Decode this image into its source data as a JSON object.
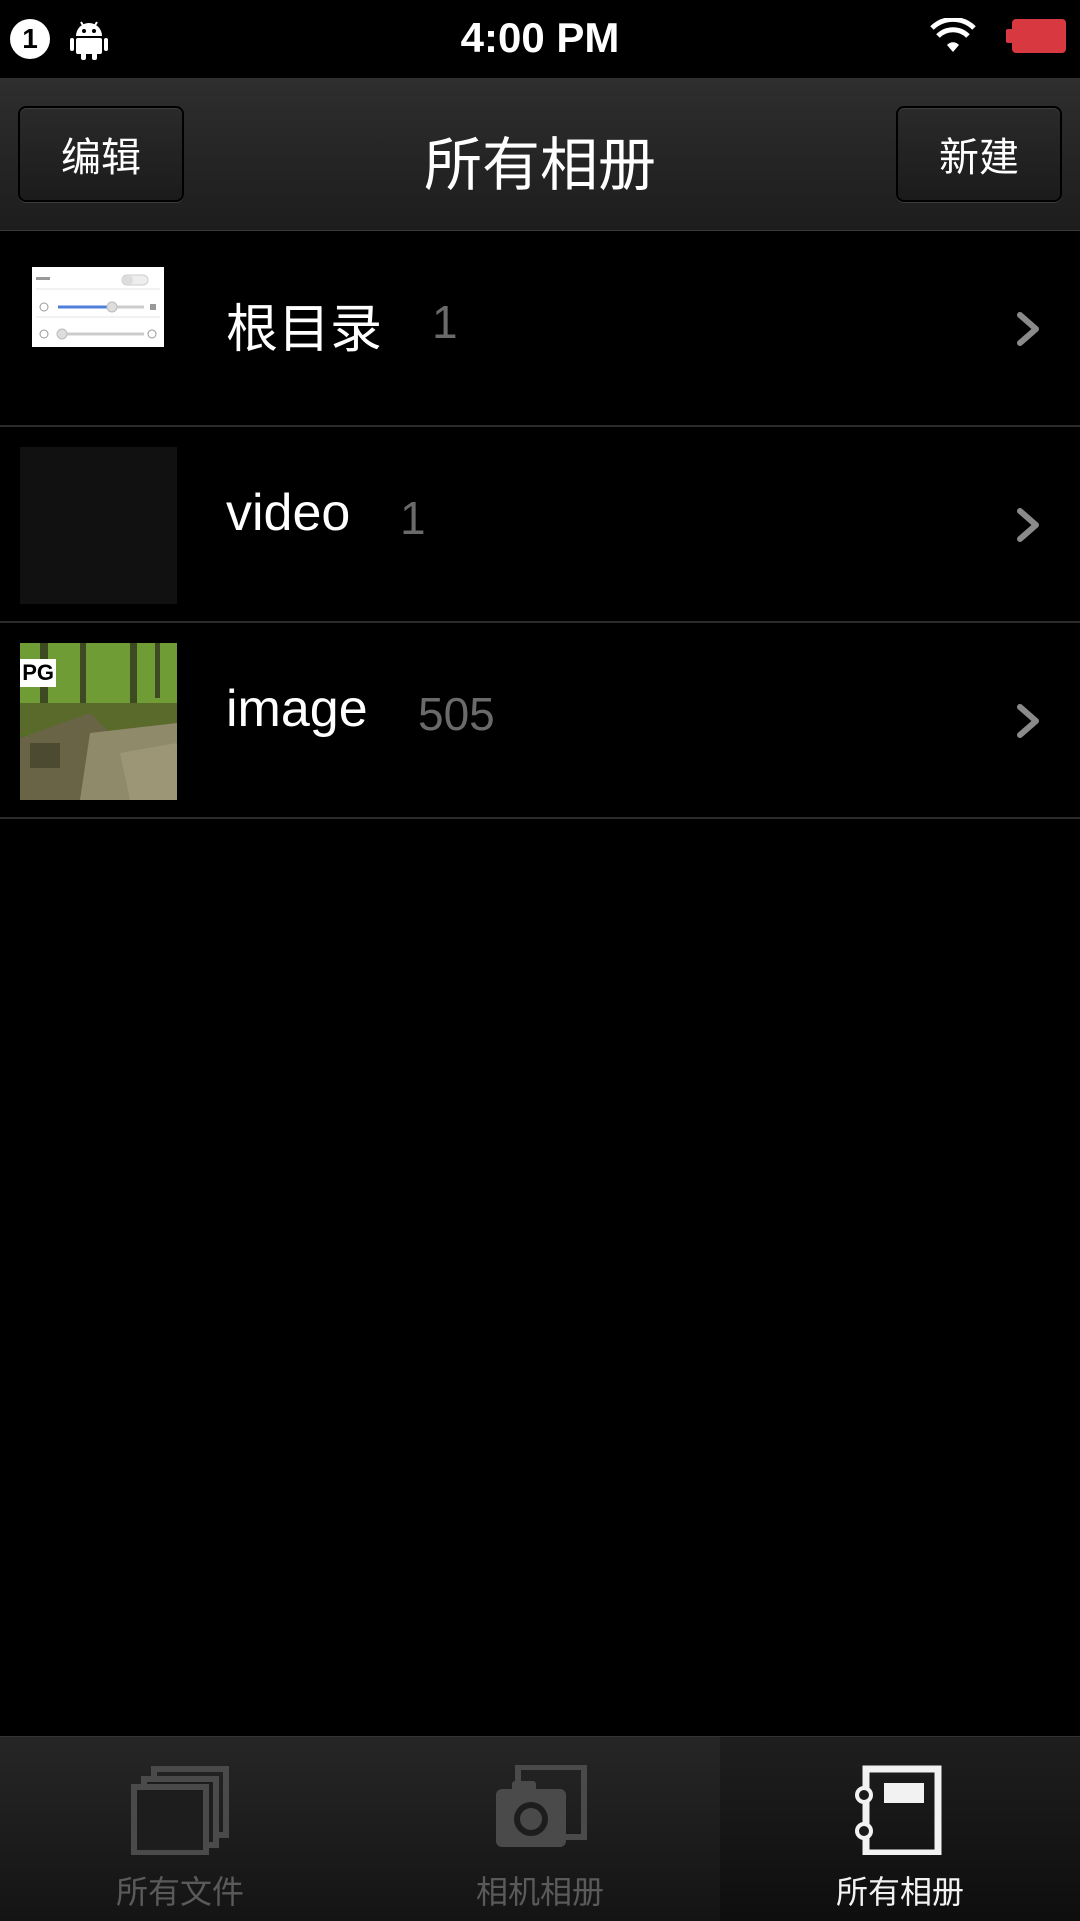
{
  "status_bar": {
    "notification_count": "1",
    "time": "4:00 PM",
    "icons": [
      "notification-badge",
      "android-icon",
      "wifi-icon",
      "battery-icon"
    ],
    "battery_color": "#d8383f"
  },
  "nav": {
    "edit_label": "编辑",
    "title": "所有相册",
    "new_label": "新建"
  },
  "albums": [
    {
      "name": "根目录",
      "count": "1"
    },
    {
      "name": "video",
      "count": "1"
    },
    {
      "name": "image",
      "count": "505"
    }
  ],
  "thumb_badge": "PG",
  "tabs": [
    {
      "label": "所有文件",
      "icon": "stacked-files-icon",
      "active": false
    },
    {
      "label": "相机相册",
      "icon": "camera-icon",
      "active": false
    },
    {
      "label": "所有相册",
      "icon": "album-book-icon",
      "active": true
    }
  ]
}
